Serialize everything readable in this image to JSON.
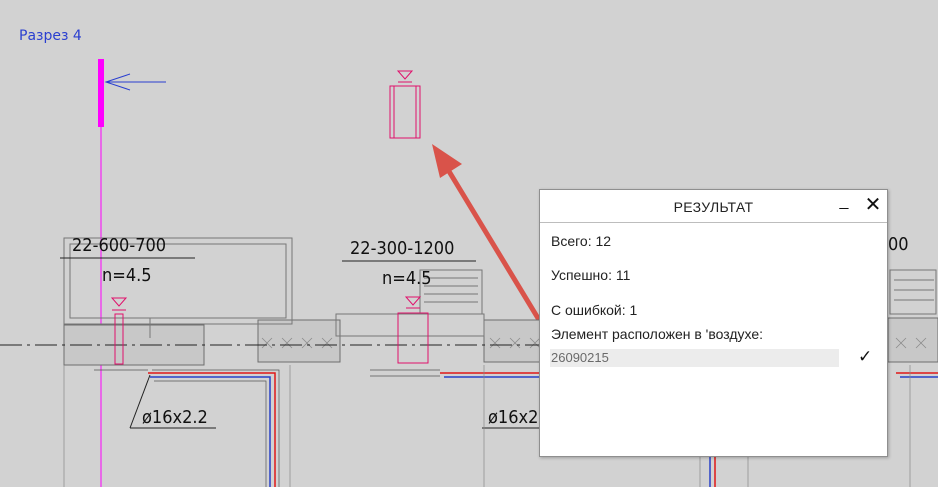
{
  "drawing": {
    "section_label": "Разрез 4",
    "duct_1": {
      "size": "22-600-700",
      "n": "n=4.5"
    },
    "duct_2": {
      "size": "22-300-1200",
      "n": "n=4.5"
    },
    "duct_3": {
      "size_partial": "00"
    },
    "pipe_1": "ø16x2.2",
    "pipe_2": "ø16x2"
  },
  "dialog": {
    "title": "РЕЗУЛЬТАТ",
    "minimize": "_",
    "close": "✕",
    "total": "Всего: 12",
    "success": "Успешно: 11",
    "errors": "С ошибкой: 1",
    "message": "Элемент расположен в 'воздухе:",
    "element_id": "26090215",
    "check": "✓"
  },
  "colors": {
    "background": "#d2d2d2",
    "magenta": "#ff00ff",
    "pink": "#e0106b",
    "blue": "#2840c8",
    "red_pipe": "#e01818",
    "arrow": "#d9534a"
  }
}
